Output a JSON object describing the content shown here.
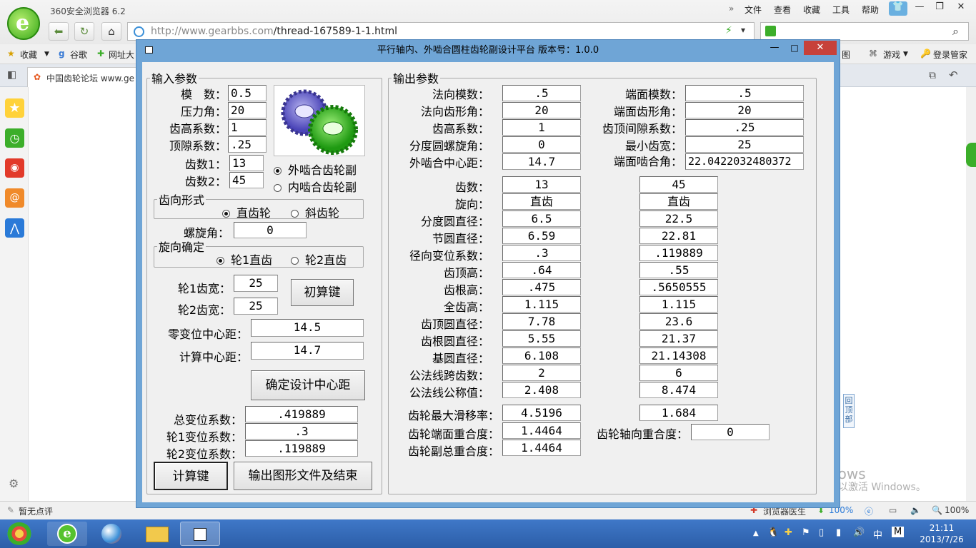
{
  "browser": {
    "title": "360安全浏览器 6.2",
    "url_host": "http://www.gearbbs.com",
    "url_path": "/thread-167589-1-1.html",
    "menus": [
      "文件",
      "查看",
      "收藏",
      "工具",
      "帮助"
    ],
    "fav_items": [
      "收藏",
      "谷歌",
      "网址大"
    ],
    "fav_right": [
      "图",
      "游戏",
      "登录管家"
    ],
    "tab_title": "中国齿轮论坛 www.ge",
    "status_left": "暂无点评",
    "status_doctor": "浏览器医生",
    "status_dl": "100%",
    "zoom": "100%",
    "back_top": "回顶部",
    "watermark_title": "激活 Windows",
    "watermark_sub": "转到\"电脑设置\"以激活 Windows。"
  },
  "taskbar": {
    "time": "21:11",
    "date": "2013/7/26",
    "ime": "中",
    "ime_mode": "M"
  },
  "app": {
    "title": "平行轴内、外啮合圆柱齿轮副设计平台 版本号：1.0.0",
    "input": {
      "legend": "输入参数",
      "module_label": "模　数：",
      "module": "0.5",
      "pressure_angle_label": "压力角：",
      "pressure_angle": "20",
      "addendum_coef_label": "齿高系数：",
      "addendum_coef": "1",
      "clearance_coef_label": "顶隙系数：",
      "clearance_coef": ".25",
      "z1_label": "齿数1：",
      "z1": "13",
      "z2_label": "齿数2：",
      "z2": "45",
      "mesh_external": "外啮合齿轮副",
      "mesh_internal": "内啮合齿轮副",
      "tooth_form_legend": "齿向形式",
      "spur": "直齿轮",
      "helical": "斜齿轮",
      "helix_angle_label": "螺旋角：",
      "helix_angle": "0",
      "hand_legend": "旋向确定",
      "gear1_spur": "轮1直齿",
      "gear2_spur": "轮2直齿",
      "width1_label": "轮1齿宽：",
      "width1": "25",
      "width2_label": "轮2齿宽：",
      "width2": "25",
      "prelim_button": "初算键",
      "zero_shift_cd_label": "零变位中心距：",
      "zero_shift_cd": "14.5",
      "calc_cd_label": "计算中心距：",
      "calc_cd": "14.7",
      "confirm_cd_button": "确定设计中心距",
      "total_shift_label": "总变位系数：",
      "total_shift": ".419889",
      "shift1_label": "轮1变位系数：",
      "shift1": ".3",
      "shift2_label": "轮2变位系数：",
      "shift2": ".119889",
      "calc_button": "计算键",
      "export_button": "输出图形文件及结束"
    },
    "output": {
      "legend": "输出参数",
      "normal_module_label": "法向模数：",
      "normal_module": ".5",
      "normal_pa_label": "法向齿形角：",
      "normal_pa": "20",
      "addendum_label": "齿高系数：",
      "addendum": "1",
      "ref_helix_label": "分度圆螺旋角：",
      "ref_helix": "0",
      "ext_cd_label": "外啮合中心距：",
      "ext_cd": "14.7",
      "transverse_module_label": "端面模数：",
      "transverse_module": ".5",
      "transverse_pa_label": "端面齿形角：",
      "transverse_pa": "20",
      "tip_clearance_label": "齿顶间隙系数：",
      "tip_clearance": ".25",
      "min_width_label": "最小齿宽：",
      "min_width": "25",
      "working_pa_label": "端面啮合角：",
      "working_pa": "22.0422032480372",
      "rows": [
        {
          "label": "齿数：",
          "g1": "13",
          "g2": "45"
        },
        {
          "label": "旋向：",
          "g1": "直齿",
          "g2": "直齿"
        },
        {
          "label": "分度圆直径：",
          "g1": "6.5",
          "g2": "22.5"
        },
        {
          "label": "节圆直径：",
          "g1": "6.59",
          "g2": "22.81"
        },
        {
          "label": "径向变位系数：",
          "g1": ".3",
          "g2": ".119889"
        },
        {
          "label": "齿顶高：",
          "g1": ".64",
          "g2": ".55"
        },
        {
          "label": "齿根高：",
          "g1": ".475",
          "g2": ".5650555"
        },
        {
          "label": "全齿高：",
          "g1": "1.115",
          "g2": "1.115"
        },
        {
          "label": "齿顶圆直径：",
          "g1": "7.78",
          "g2": "23.6"
        },
        {
          "label": "齿根圆直径：",
          "g1": "5.55",
          "g2": "21.37"
        },
        {
          "label": "基圆直径：",
          "g1": "6.108",
          "g2": "21.14308"
        },
        {
          "label": "公法线跨齿数：",
          "g1": "2",
          "g2": "6"
        },
        {
          "label": "公法线公称值：",
          "g1": "2.408",
          "g2": "8.474"
        }
      ],
      "max_slip_label": "齿轮最大滑移率：",
      "max_slip1": "4.5196",
      "max_slip2": "1.684",
      "transverse_contact_label": "齿轮端面重合度：",
      "transverse_contact": "1.4464",
      "total_contact_label": "齿轮副总重合度：",
      "total_contact": "1.4464",
      "axial_contact_label": "齿轮轴向重合度：",
      "axial_contact": "0"
    }
  }
}
